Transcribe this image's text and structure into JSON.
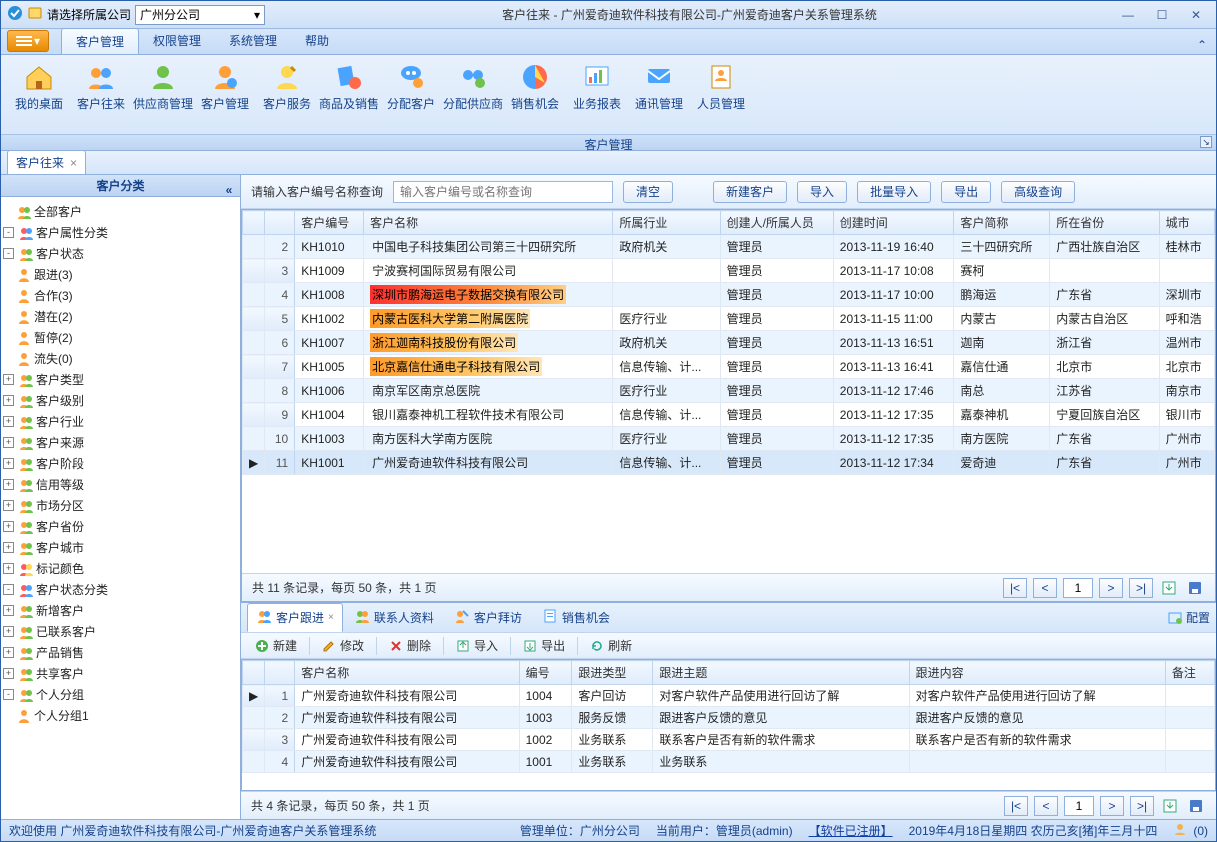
{
  "titlebar": {
    "company_selector_label": "请选择所属公司",
    "company_selector_value": "广州分公司",
    "title": "客户往来 - 广州爱奇迪软件科技有限公司-广州爱奇迪客户关系管理系统"
  },
  "ribbon": {
    "tabs": [
      "客户管理",
      "权限管理",
      "系统管理",
      "帮助"
    ],
    "items": [
      {
        "label": "我的桌面"
      },
      {
        "label": "客户往来"
      },
      {
        "label": "供应商管理"
      },
      {
        "label": "客户管理"
      },
      {
        "label": "客户服务"
      },
      {
        "label": "商品及销售"
      },
      {
        "label": "分配客户"
      },
      {
        "label": "分配供应商"
      },
      {
        "label": "销售机会"
      },
      {
        "label": "业务报表"
      },
      {
        "label": "通讯管理"
      },
      {
        "label": "人员管理"
      }
    ],
    "group_label": "客户管理"
  },
  "doc_tab": {
    "label": "客户往来"
  },
  "sidebar": {
    "title": "客户分类",
    "nodes": {
      "all": "全部客户",
      "attr_group": "客户属性分类",
      "status": "客户状态",
      "status_children": [
        "跟进(3)",
        "合作(3)",
        "潜在(2)",
        "暂停(2)",
        "流失(0)"
      ],
      "attr_items": [
        "客户类型",
        "客户级别",
        "客户行业",
        "客户来源",
        "客户阶段",
        "信用等级",
        "市场分区",
        "客户省份",
        "客户城市"
      ],
      "mark_color": "标记颜色",
      "status_group": "客户状态分类",
      "status_group_items": [
        "新增客户",
        "已联系客户",
        "产品销售",
        "共享客户"
      ],
      "personal_group": "个人分组",
      "personal_item": "个人分组1"
    }
  },
  "search": {
    "label": "请输入客户编号名称查询",
    "placeholder": "输入客户编号或名称查询",
    "btn_clear": "清空",
    "btn_new": "新建客户",
    "btn_import": "导入",
    "btn_batch": "批量导入",
    "btn_export": "导出",
    "btn_adv": "高级查询"
  },
  "grid": {
    "columns": [
      "客户编号",
      "客户名称",
      "所属行业",
      "创建人/所属人员",
      "创建时间",
      "客户简称",
      "所在省份",
      "城市"
    ],
    "rows": [
      {
        "n": 2,
        "id": "KH1010",
        "name": "中国电子科技集团公司第三十四研究所",
        "industry": "政府机关",
        "creator": "管理员",
        "time": "2013-11-19 16:40",
        "short": "三十四研究所",
        "province": "广西壮族自治区",
        "city": "桂林市",
        "hl": ""
      },
      {
        "n": 3,
        "id": "KH1009",
        "name": "宁波赛柯国际贸易有限公司",
        "industry": "",
        "creator": "管理员",
        "time": "2013-11-17 10:08",
        "short": "赛柯",
        "province": "",
        "city": "",
        "hl": ""
      },
      {
        "n": 4,
        "id": "KH1008",
        "name": "深圳市鹏海运电子数据交换有限公司",
        "industry": "",
        "creator": "管理员",
        "time": "2013-11-17 10:00",
        "short": "鹏海运",
        "province": "广东省",
        "city": "深圳市",
        "hl": "red"
      },
      {
        "n": 5,
        "id": "KH1002",
        "name": "内蒙古医科大学第二附属医院",
        "industry": "医疗行业",
        "creator": "管理员",
        "time": "2013-11-15 11:00",
        "short": "内蒙古",
        "province": "内蒙古自治区",
        "city": "呼和浩",
        "hl": "org"
      },
      {
        "n": 6,
        "id": "KH1007",
        "name": "浙江迦南科技股份有限公司",
        "industry": "政府机关",
        "creator": "管理员",
        "time": "2013-11-13 16:51",
        "short": "迦南",
        "province": "浙江省",
        "city": "温州市",
        "hl": "org"
      },
      {
        "n": 7,
        "id": "KH1005",
        "name": "北京嘉信仕通电子科技有限公司",
        "industry": "信息传输、计...",
        "creator": "管理员",
        "time": "2013-11-13 16:41",
        "short": "嘉信仕通",
        "province": "北京市",
        "city": "北京市",
        "hl": "org"
      },
      {
        "n": 8,
        "id": "KH1006",
        "name": "南京军区南京总医院",
        "industry": "医疗行业",
        "creator": "管理员",
        "time": "2013-11-12 17:46",
        "short": "南总",
        "province": "江苏省",
        "city": "南京市",
        "hl": ""
      },
      {
        "n": 9,
        "id": "KH1004",
        "name": "银川嘉泰神机工程软件技术有限公司",
        "industry": "信息传输、计...",
        "creator": "管理员",
        "time": "2013-11-12 17:35",
        "short": "嘉泰神机",
        "province": "宁夏回族自治区",
        "city": "银川市",
        "hl": ""
      },
      {
        "n": 10,
        "id": "KH1003",
        "name": "南方医科大学南方医院",
        "industry": "医疗行业",
        "creator": "管理员",
        "time": "2013-11-12 17:35",
        "short": "南方医院",
        "province": "广东省",
        "city": "广州市",
        "hl": ""
      },
      {
        "n": 11,
        "id": "KH1001",
        "name": "广州爱奇迪软件科技有限公司",
        "industry": "信息传输、计...",
        "creator": "管理员",
        "time": "2013-11-12 17:34",
        "short": "爱奇迪",
        "province": "广东省",
        "city": "广州市",
        "hl": ""
      }
    ],
    "pager_summary": "共 11 条记录，每页 50 条，共 1 页",
    "page": "1"
  },
  "detail": {
    "tabs": [
      "客户跟进",
      "联系人资料",
      "客户拜访",
      "销售机会"
    ],
    "config_label": "配置",
    "toolbar": {
      "new": "新建",
      "edit": "修改",
      "delete": "删除",
      "import": "导入",
      "export": "导出",
      "refresh": "刷新"
    },
    "columns": [
      "客户名称",
      "编号",
      "跟进类型",
      "跟进主题",
      "跟进内容",
      "备注"
    ],
    "rows": [
      {
        "n": 1,
        "name": "广州爱奇迪软件科技有限公司",
        "code": "1004",
        "type": "客户回访",
        "topic": "对客户软件产品使用进行回访了解",
        "content": "对客户软件产品使用进行回访了解",
        "remark": ""
      },
      {
        "n": 2,
        "name": "广州爱奇迪软件科技有限公司",
        "code": "1003",
        "type": "服务反馈",
        "topic": "跟进客户反馈的意见",
        "content": "跟进客户反馈的意见",
        "remark": ""
      },
      {
        "n": 3,
        "name": "广州爱奇迪软件科技有限公司",
        "code": "1002",
        "type": "业务联系",
        "topic": "联系客户是否有新的软件需求",
        "content": "联系客户是否有新的软件需求",
        "remark": ""
      },
      {
        "n": 4,
        "name": "广州爱奇迪软件科技有限公司",
        "code": "1001",
        "type": "业务联系",
        "topic": "业务联系",
        "content": "",
        "remark": ""
      }
    ],
    "pager_summary": "共 4 条记录，每页 50 条，共 1 页",
    "page": "1"
  },
  "statusbar": {
    "welcome": "欢迎使用 广州爱奇迪软件科技有限公司-广州爱奇迪客户关系管理系统",
    "unit_label": "管理单位：",
    "unit": "广州分公司",
    "user_label": "当前用户：",
    "user": "管理员(admin)",
    "reg": "【软件已注册】",
    "date": "2019年4月18日星期四 农历己亥[猪]年三月十四",
    "online": "(0)"
  },
  "icons": {
    "arrow": ">",
    "first": "|<",
    "prev": "<",
    "next": ">",
    "last": ">|"
  }
}
